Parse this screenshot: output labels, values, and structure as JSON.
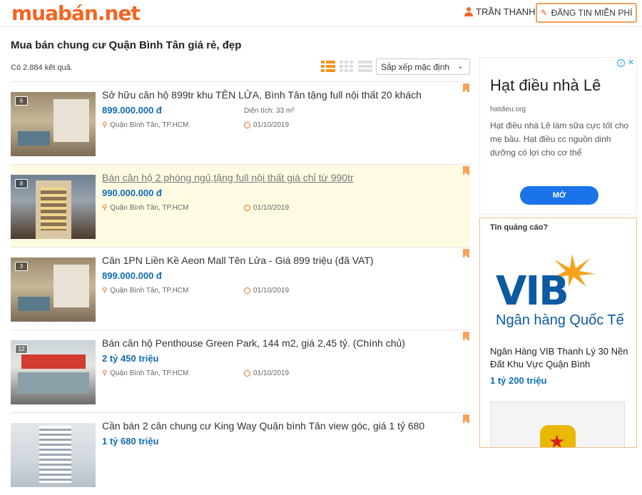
{
  "header": {
    "logo_part1": "muabán",
    "logo_part2": ".net",
    "user_name": "TRẦN THANH",
    "post_button": "ĐĂNG TIN MIỄN PHÍ"
  },
  "page": {
    "title": "Mua bán chung cư Quận Bình Tân giá rẻ, đẹp",
    "result_count": "Có 2.884 kết quả.",
    "sort": {
      "selected": "Sắp xếp mặc định"
    }
  },
  "listings": [
    {
      "image_count": "6",
      "title": "Sở hữu căn hộ 899tr khu TÊN LỬA, Bình Tân tặng full nội thất 20 khách",
      "price": "899.000.000 đ",
      "area": "Diện tích: 33 m²",
      "location": "Quận Bình Tân, TP.HCM",
      "date": "01/10/2019",
      "highlighted": false
    },
    {
      "image_count": "8",
      "title": "Bán căn hộ 2 phòng ngủ,tặng full nội thất giá chỉ từ 990tr",
      "price": "990.000.000 đ",
      "area": "",
      "location": "Quận Bình Tân, TP.HCM",
      "date": "01/10/2019",
      "highlighted": true
    },
    {
      "image_count": "3",
      "title": "Căn 1PN Liền Kề Aeon Mall Tên Lửa - Giá 899 triệu (đã VAT)",
      "price": "899.000.000 đ",
      "area": "",
      "location": "Quận Bình Tân, TP.HCM",
      "date": "01/10/2019",
      "highlighted": false
    },
    {
      "image_count": "12",
      "title": "Bán căn hộ Penthouse Green Park, 144 m2, giá 2,45 tỷ. (Chính chủ)",
      "price": "2 tỷ 450 triệu",
      "area": "",
      "location": "Quận Bình Tân, TP.HCM",
      "date": "01/10/2019",
      "highlighted": false
    },
    {
      "image_count": "",
      "title": "Cần bán 2 căn chung cư King Way Quận bình Tân view góc, giá 1 tỷ 680",
      "price": "1 tỷ 680 triệu",
      "area": "",
      "location": "",
      "date": "",
      "highlighted": false
    }
  ],
  "ad_google": {
    "title": "Hạt điều nhà Lê",
    "url": "hatdieu.org",
    "description": "Hạt điều nhà Lê làm sữa cực tốt cho mẹ bầu. Hạt điều cc nguồn dinh dưỡng có lợi cho cơ thể",
    "button": "MỞ"
  },
  "ad_sidebar": {
    "question": "Tin quảng cáo?",
    "logo_text": "VIB",
    "logo_sub": "Ngân hàng Quốc Tế",
    "text": "Ngân Hàng VIB Thanh Lý 30 Nền Đất Khu Vực Quận Bình",
    "price": "1 tỷ 200 triệu"
  },
  "colors": {
    "brand": "#f26522",
    "price": "#0f6cb6",
    "highlight_bg": "#fffbe3",
    "vib_blue": "#0b5aa2"
  }
}
